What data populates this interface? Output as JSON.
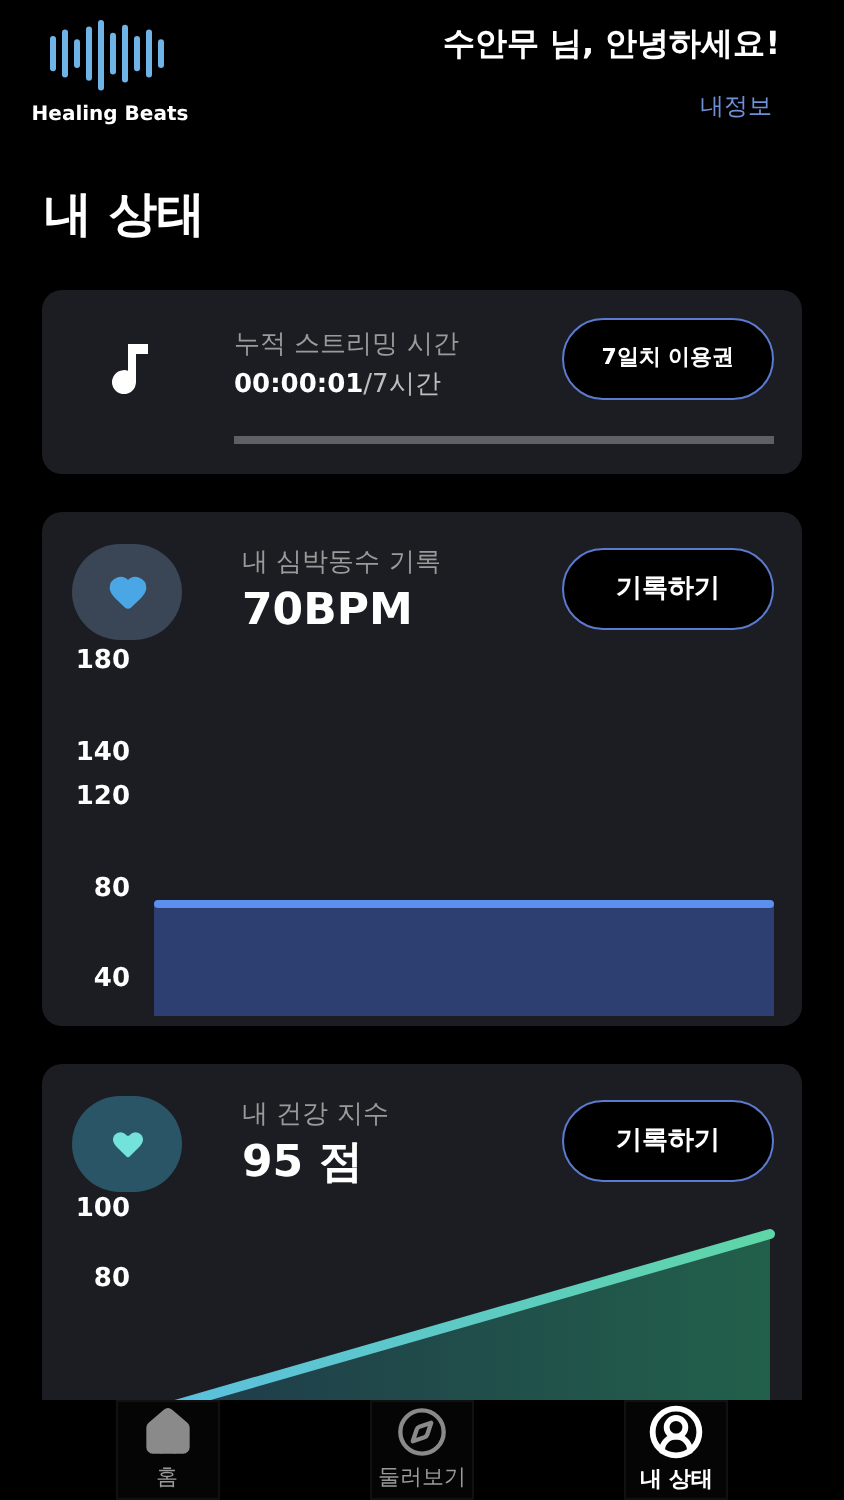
{
  "header": {
    "logo_text": "Healing Beats",
    "greeting": "수안무 님, 안녕하세요!",
    "profile_link": "내정보"
  },
  "page_title": "내 상태",
  "streaming": {
    "label": "누적 스트리밍 시간",
    "elapsed": "00:00:01",
    "total": "/7시간",
    "pass_button": "7일치 이용권",
    "level": 0
  },
  "heart_rate": {
    "label": "내 심박동수 기록",
    "value": "70BPM",
    "button": "기록하기",
    "axis_labels": [
      "180",
      "140",
      "120",
      "80",
      "40"
    ]
  },
  "health_index": {
    "label": "내 건강 지수",
    "value": "95 점",
    "button": "기록하기",
    "axis_labels": [
      "100",
      "80"
    ]
  },
  "nav": [
    {
      "label": "홈",
      "kind": "home",
      "selected": false
    },
    {
      "label": "둘러보기",
      "kind": "explore",
      "selected": false
    },
    {
      "label": "내 상태",
      "kind": "profile",
      "selected": true
    }
  ]
}
